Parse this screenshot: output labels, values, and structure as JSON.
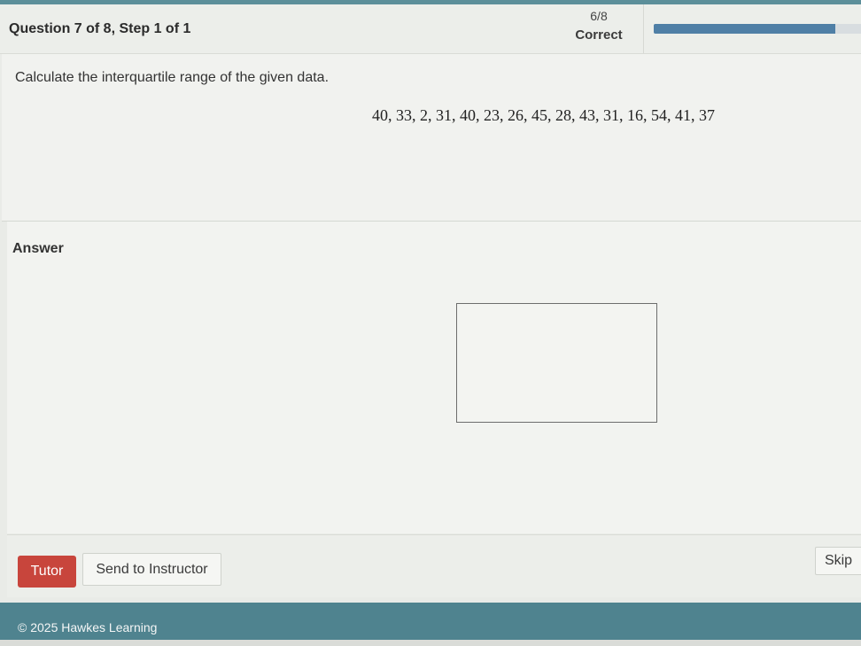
{
  "header": {
    "question_label": "Question 7 of 8,  Step 1 of 1",
    "score_count": "6/8",
    "score_status": "Correct",
    "progress_fraction": 0.875,
    "progress_color": "#4f7fa6"
  },
  "question": {
    "prompt": "Calculate the interquartile range of the given data.",
    "dataset": "40, 33, 2, 31, 40, 23, 26, 45, 28, 43, 31, 16, 54, 41, 37"
  },
  "answer": {
    "label": "Answer",
    "input_value": ""
  },
  "actions": {
    "tutor_label": "Tutor",
    "tutor_color": "#c8453c",
    "send_label": "Send to Instructor",
    "skip_label": "Skip"
  },
  "footer": {
    "copyright": "© 2025 Hawkes Learning",
    "color": "#4f838f"
  }
}
